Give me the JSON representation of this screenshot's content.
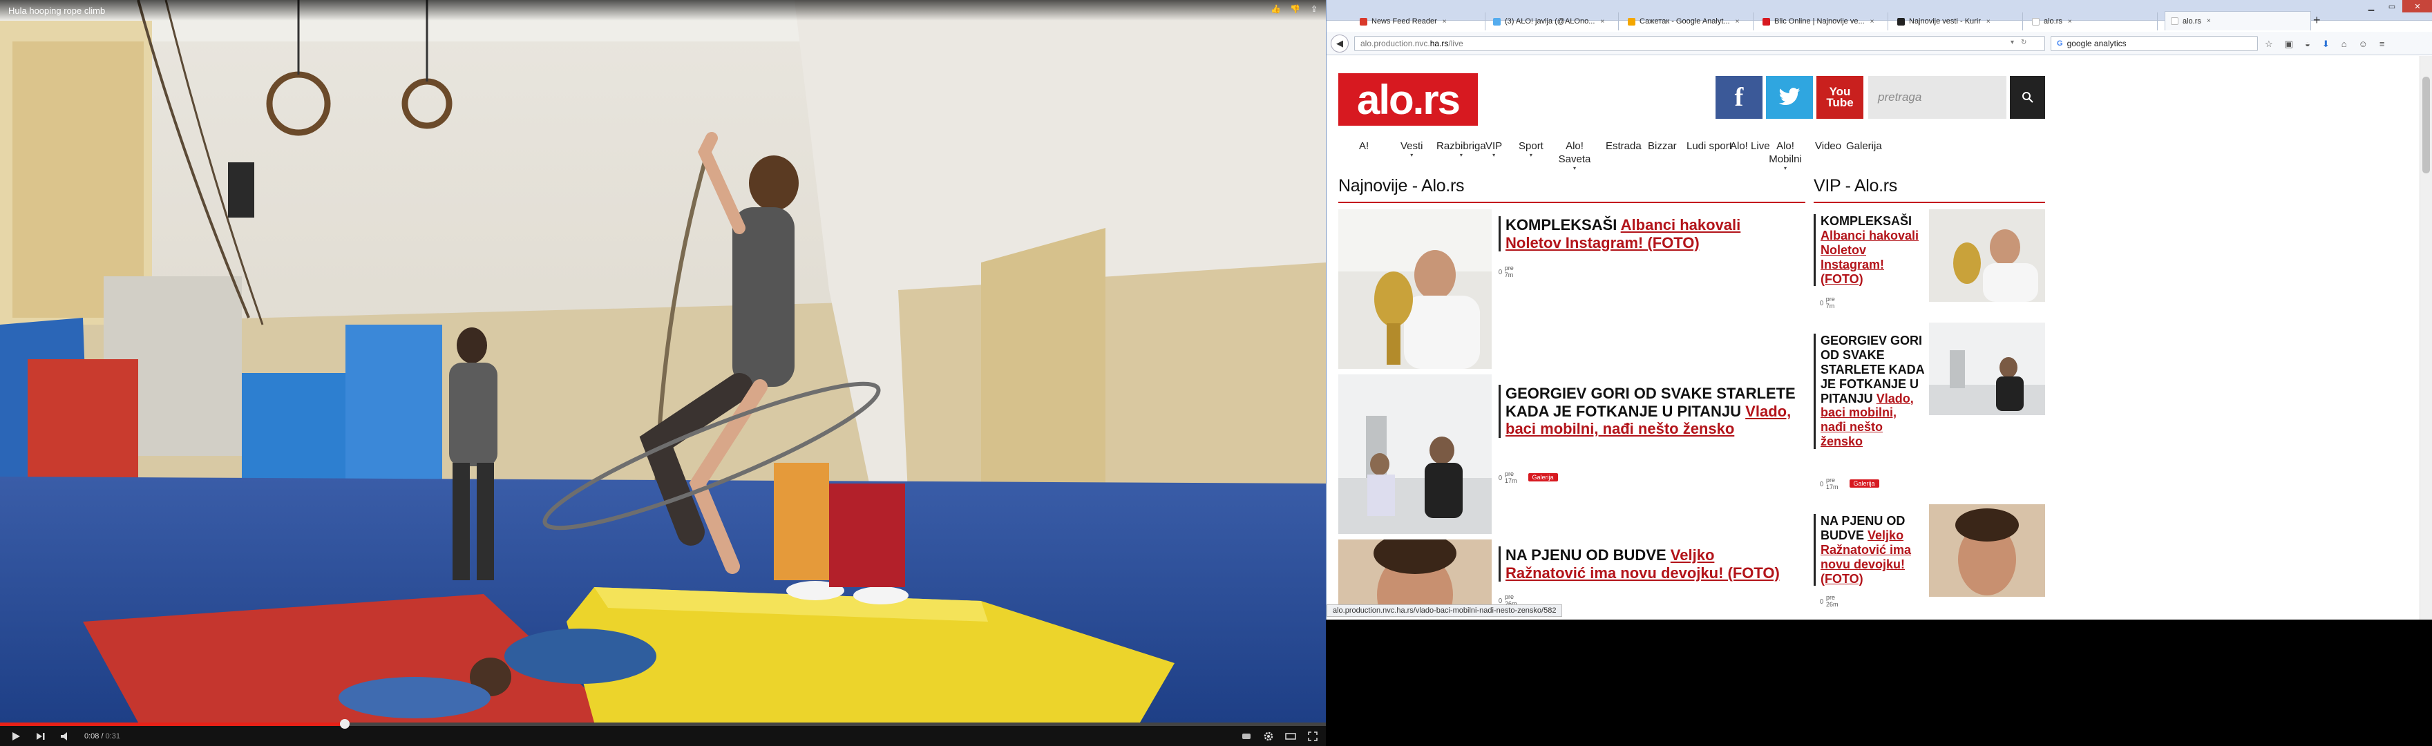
{
  "player": {
    "title": "Hula hooping rope climb",
    "time_current": "0:08",
    "time_duration": "0:31",
    "progress": 0.26
  },
  "browser": {
    "tabs": [
      {
        "label": "News Feed Reader",
        "color": "#d9392b"
      },
      {
        "label": "(3) ALO! javlja (@ALOno...",
        "color": "#55acee"
      },
      {
        "label": "Сажетак - Google Analyt...",
        "color": "#f4a700"
      },
      {
        "label": "Blic Online | Najnovije ve...",
        "color": "#d71920"
      },
      {
        "label": "Najnovije vesti - Kurir",
        "color": "#222222"
      },
      {
        "label": "alo.rs",
        "color": "#ffffff"
      },
      {
        "label": "alo.rs",
        "color": "#ffffff"
      }
    ],
    "url_prefix": "alo.production.nvc.",
    "url_host": "ha.rs",
    "url_suffix": "/live",
    "search_text": "google analytics",
    "status_url": "alo.production.nvc.ha.rs/vlado-baci-mobilni-nadi-nesto-zensko/582"
  },
  "site": {
    "logo": "alo",
    "logo_suffix": "rs",
    "search_placeholder": "pretraga",
    "menu": [
      {
        "label": "A!",
        "sub": false
      },
      {
        "label": "Vesti",
        "sub": true
      },
      {
        "label": "Razbibriga",
        "sub": true
      },
      {
        "label": "VIP",
        "sub": true
      },
      {
        "label": "Sport",
        "sub": true
      },
      {
        "label": "Alo! Saveta",
        "sub": true
      },
      {
        "label": "Estrada",
        "sub": false
      },
      {
        "label": "Bizzar",
        "sub": false
      },
      {
        "label": "Ludi sport",
        "sub": false
      },
      {
        "label": "Alo! Live",
        "sub": false
      },
      {
        "label": "Alo! Mobilni",
        "sub": true
      },
      {
        "label": "Video",
        "sub": false
      },
      {
        "label": "Galerija",
        "sub": false
      }
    ],
    "section_left": "Najnovije - Alo.rs",
    "section_right": "VIP - Alo.rs",
    "gallery_badge": "Galerija",
    "articles": [
      {
        "kicker": "KOMPLEKSAŠI",
        "title": "Albanci hakovali Noletov Instagram! (FOTO)",
        "time": "pre 7m",
        "gallery": false
      },
      {
        "kicker": "GEORGIEV GORI OD SVAKE STARLETE KADA JE FOTKANJE U PITANJU",
        "title": "Vlado, baci mobilni, nađi nešto žensko",
        "time": "pre 17m",
        "gallery": true
      },
      {
        "kicker": "NA PJENU OD BUDVE",
        "title": "Veljko Ražnatović ima novu devojku! (FOTO)",
        "time": "pre 26m",
        "gallery": false
      }
    ]
  }
}
